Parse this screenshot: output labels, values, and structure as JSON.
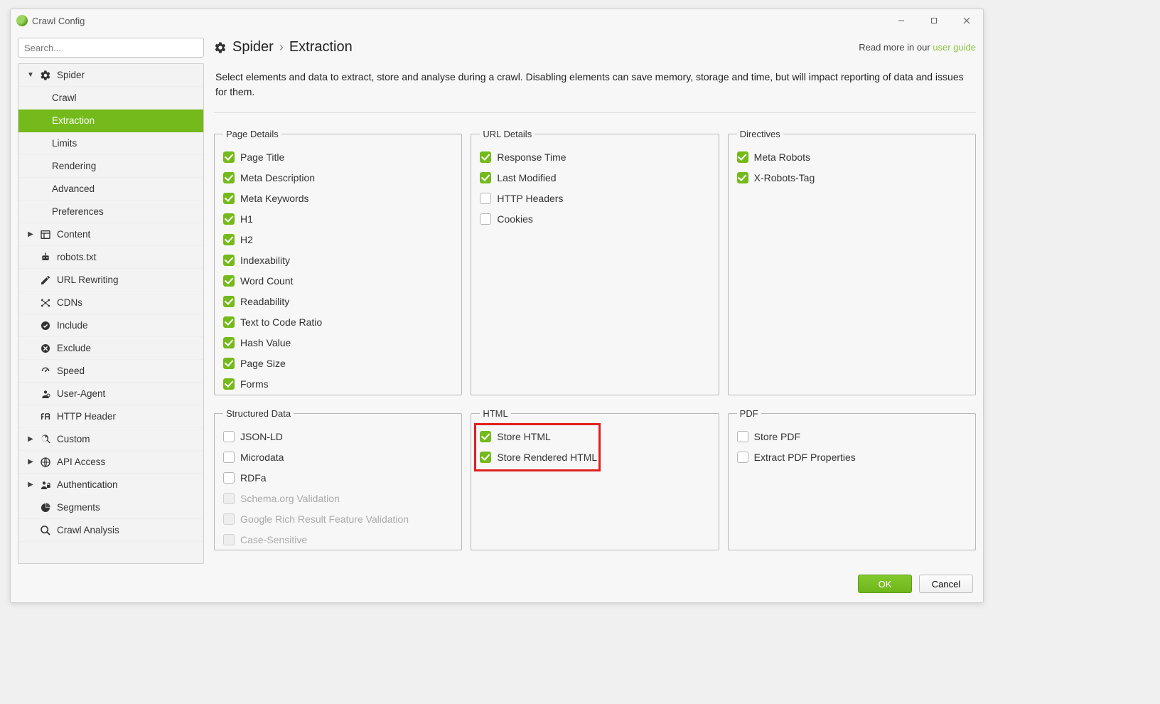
{
  "window": {
    "title": "Crawl Config"
  },
  "sidebar": {
    "search_placeholder": "Search...",
    "items": [
      {
        "label": "Spider",
        "level": 1,
        "arrow": "down",
        "icon": "gear"
      },
      {
        "label": "Crawl",
        "level": 2
      },
      {
        "label": "Extraction",
        "level": 2,
        "selected": true
      },
      {
        "label": "Limits",
        "level": 2
      },
      {
        "label": "Rendering",
        "level": 2
      },
      {
        "label": "Advanced",
        "level": 2
      },
      {
        "label": "Preferences",
        "level": 2
      },
      {
        "label": "Content",
        "level": 1,
        "arrow": "right",
        "icon": "content"
      },
      {
        "label": "robots.txt",
        "level": 1,
        "arrow": "blank",
        "icon": "robot"
      },
      {
        "label": "URL Rewriting",
        "level": 1,
        "arrow": "blank",
        "icon": "edit"
      },
      {
        "label": "CDNs",
        "level": 1,
        "arrow": "blank",
        "icon": "cdn"
      },
      {
        "label": "Include",
        "level": 1,
        "arrow": "blank",
        "icon": "include"
      },
      {
        "label": "Exclude",
        "level": 1,
        "arrow": "blank",
        "icon": "exclude"
      },
      {
        "label": "Speed",
        "level": 1,
        "arrow": "blank",
        "icon": "speed"
      },
      {
        "label": "User-Agent",
        "level": 1,
        "arrow": "blank",
        "icon": "useragent"
      },
      {
        "label": "HTTP Header",
        "level": 1,
        "arrow": "blank",
        "icon": "httpheader"
      },
      {
        "label": "Custom",
        "level": 1,
        "arrow": "right",
        "icon": "custom"
      },
      {
        "label": "API Access",
        "level": 1,
        "arrow": "right",
        "icon": "api"
      },
      {
        "label": "Authentication",
        "level": 1,
        "arrow": "right",
        "icon": "auth"
      },
      {
        "label": "Segments",
        "level": 1,
        "arrow": "blank",
        "icon": "segments"
      },
      {
        "label": "Crawl Analysis",
        "level": 1,
        "arrow": "blank",
        "icon": "analysis"
      }
    ]
  },
  "breadcrumb": {
    "part1": "Spider",
    "part2": "Extraction"
  },
  "readmore": {
    "prefix": "Read more in our ",
    "link": "user guide"
  },
  "description": "Select elements and data to extract, store and analyse during a crawl. Disabling elements can save memory, storage and time, but will impact reporting of data and issues for them.",
  "groups": {
    "page_details": {
      "legend": "Page Details",
      "items": [
        {
          "label": "Page Title",
          "checked": true
        },
        {
          "label": "Meta Description",
          "checked": true
        },
        {
          "label": "Meta Keywords",
          "checked": true
        },
        {
          "label": "H1",
          "checked": true
        },
        {
          "label": "H2",
          "checked": true
        },
        {
          "label": "Indexability",
          "checked": true
        },
        {
          "label": "Word Count",
          "checked": true
        },
        {
          "label": "Readability",
          "checked": true
        },
        {
          "label": "Text to Code Ratio",
          "checked": true
        },
        {
          "label": "Hash Value",
          "checked": true
        },
        {
          "label": "Page Size",
          "checked": true
        },
        {
          "label": "Forms",
          "checked": true
        }
      ]
    },
    "url_details": {
      "legend": "URL Details",
      "items": [
        {
          "label": "Response Time",
          "checked": true
        },
        {
          "label": "Last Modified",
          "checked": true
        },
        {
          "label": "HTTP Headers",
          "checked": false
        },
        {
          "label": "Cookies",
          "checked": false
        }
      ]
    },
    "directives": {
      "legend": "Directives",
      "items": [
        {
          "label": "Meta Robots",
          "checked": true
        },
        {
          "label": "X-Robots-Tag",
          "checked": true
        }
      ]
    },
    "structured_data": {
      "legend": "Structured Data",
      "items": [
        {
          "label": "JSON-LD",
          "checked": false
        },
        {
          "label": "Microdata",
          "checked": false
        },
        {
          "label": "RDFa",
          "checked": false
        },
        {
          "label": "Schema.org Validation",
          "checked": false,
          "disabled": true
        },
        {
          "label": "Google Rich Result Feature Validation",
          "checked": false,
          "disabled": true
        },
        {
          "label": "Case-Sensitive",
          "checked": false,
          "disabled": true
        }
      ]
    },
    "html": {
      "legend": "HTML",
      "items": [
        {
          "label": "Store HTML",
          "checked": true
        },
        {
          "label": "Store Rendered HTML",
          "checked": true
        }
      ],
      "highlight": true
    },
    "pdf": {
      "legend": "PDF",
      "items": [
        {
          "label": "Store PDF",
          "checked": false
        },
        {
          "label": "Extract PDF Properties",
          "checked": false
        }
      ]
    }
  },
  "footer": {
    "ok": "OK",
    "cancel": "Cancel"
  }
}
